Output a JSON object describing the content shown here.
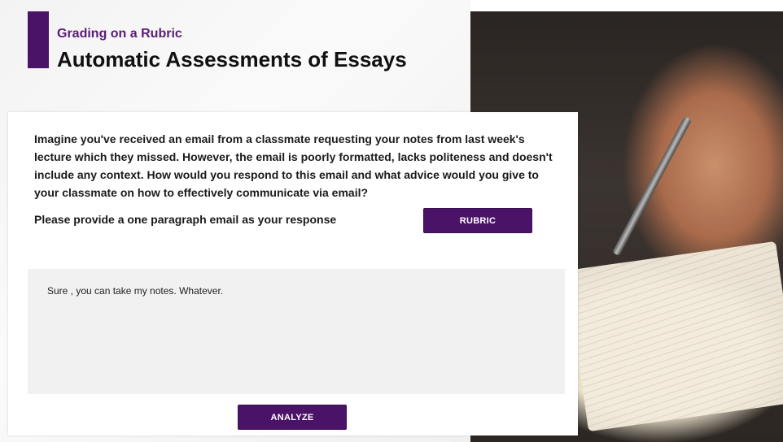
{
  "header": {
    "subtitle": "Grading on a Rubric",
    "title": "Automatic Assessments of Essays"
  },
  "card": {
    "prompt": "Imagine you've received an email from a classmate requesting your notes from last week's lecture which they missed. However, the email is poorly formatted, lacks politeness and doesn't include any context. How would you respond to this email and what advice would you give to your classmate on how to effectively communicate via email?",
    "instruction": "Please provide a one paragraph email as your response",
    "rubric_label": "RUBRIC",
    "response_value": "Sure , you can take my notes. Whatever.",
    "analyze_label": "ANALYZE"
  },
  "colors": {
    "accent": "#4b1368",
    "subtitle": "#5b1a78",
    "response_bg": "#f1f1f1"
  },
  "icons": [
    "photo-hand-writing-notebook"
  ]
}
